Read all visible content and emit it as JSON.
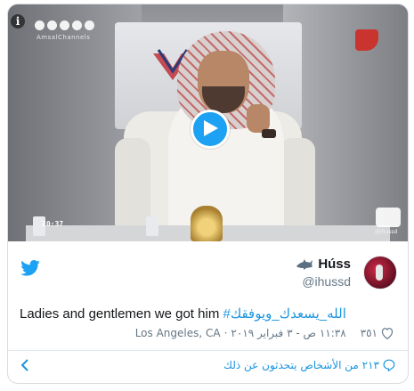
{
  "video": {
    "info_glyph": "i",
    "social_handle": "AmsalChannels",
    "timecode": "20:37",
    "channel_logo_text": "",
    "watermark_text": "@ihussd"
  },
  "tweet": {
    "display_name": "Húss",
    "handle": "@ihussd",
    "hashtag": "#الله_يسعدك_ويوفقك",
    "text_body": "Ladies and gentlemen we got him ",
    "likes": "٣٥١",
    "timestamp": "١١:٣٨ ص - ٣ فبراير ٢٠١٩",
    "location": "Los Angeles, CA"
  },
  "footer": {
    "replies_text": "٢١٣ من الأشخاص يتحدثون عن ذلك"
  },
  "colors": {
    "twitter_blue": "#1da1f2",
    "link_blue": "#1b95e0",
    "muted_text": "#657786"
  },
  "icons": [
    "info-icon",
    "twitter-bird-icon",
    "shark-icon",
    "heart-icon",
    "speech-bubble-icon",
    "chevron-left-icon",
    "play-icon"
  ]
}
